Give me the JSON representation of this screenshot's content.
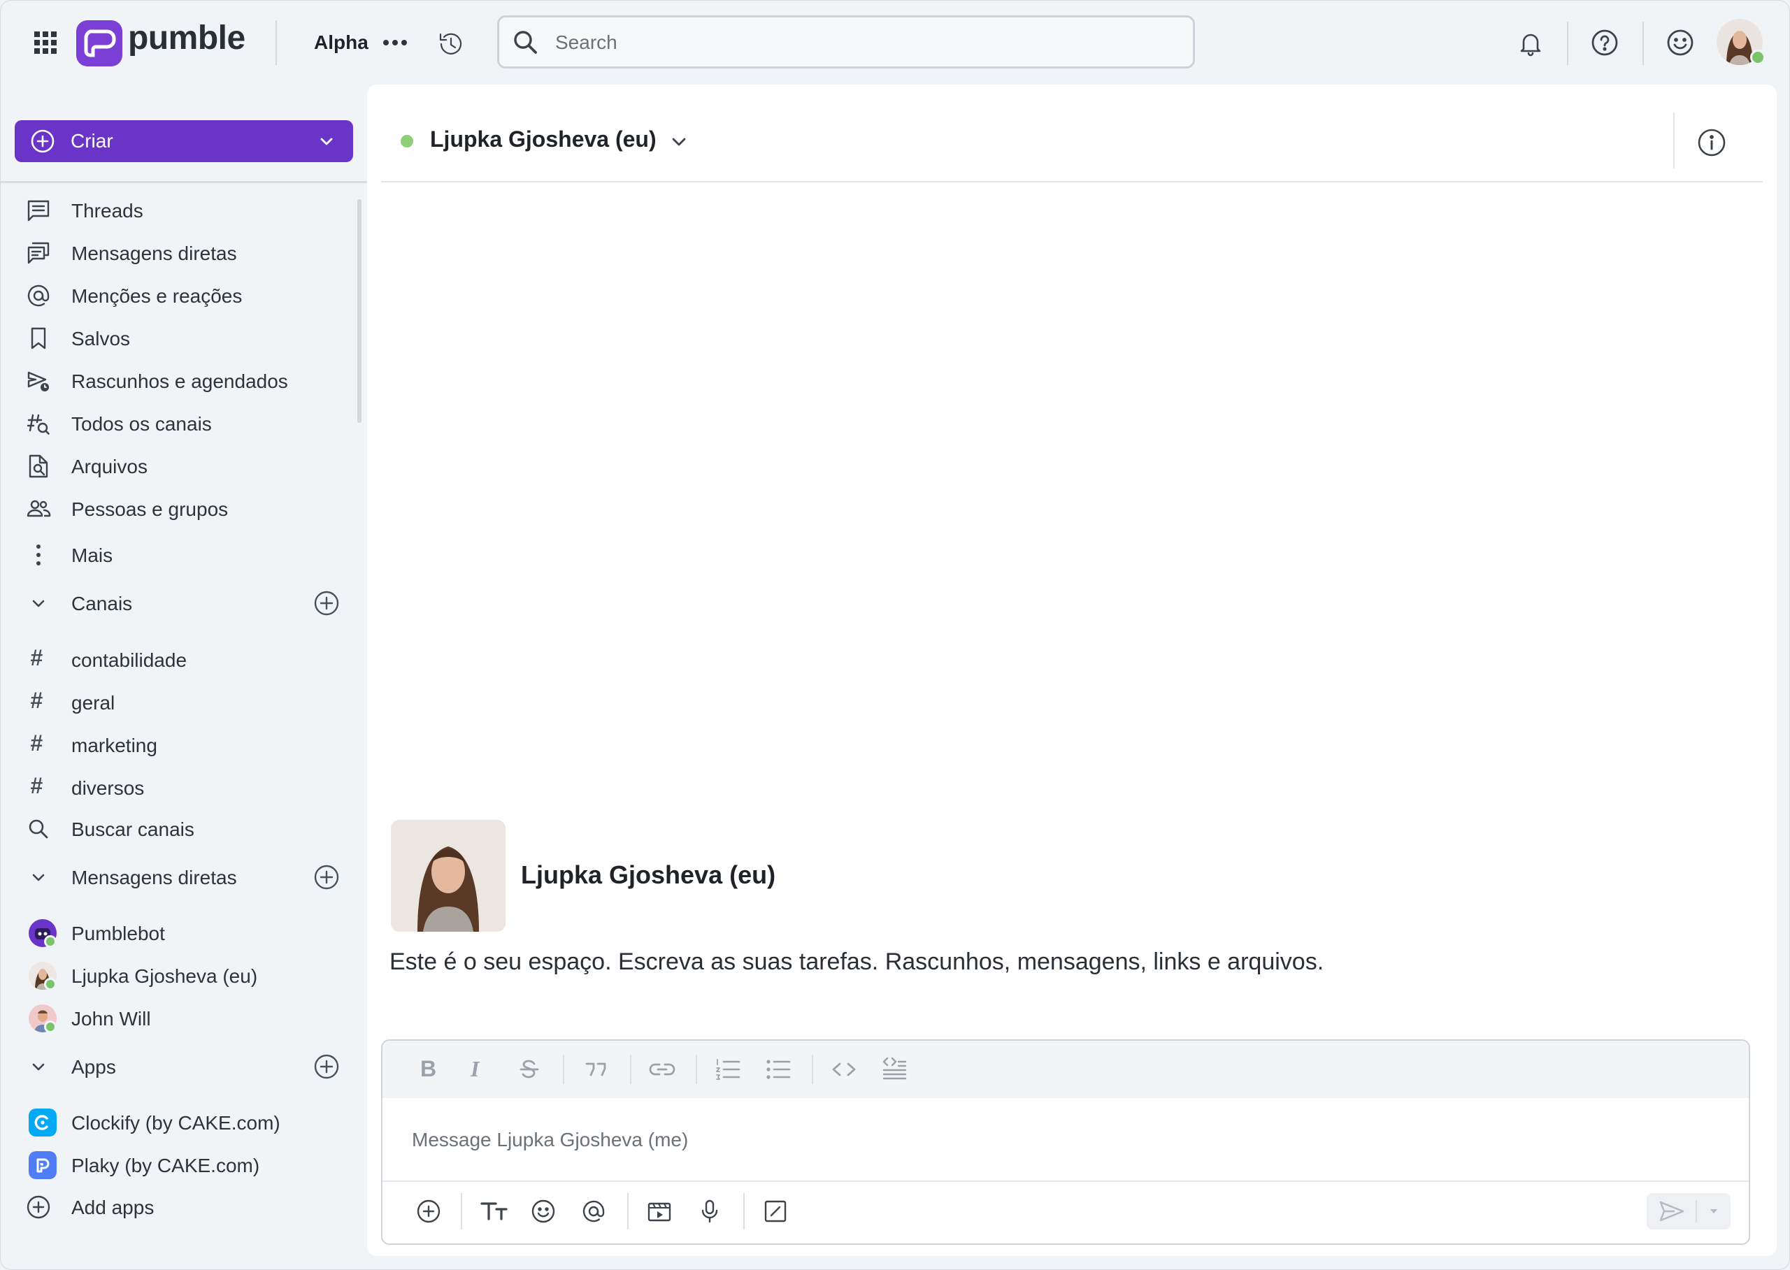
{
  "app": {
    "name": "pumble",
    "workspace": "Alpha"
  },
  "search": {
    "placeholder": "Search"
  },
  "sidebar": {
    "create_label": "Criar",
    "nav": [
      {
        "label": "Threads",
        "icon": "threads-icon"
      },
      {
        "label": "Mensagens diretas",
        "icon": "direct-messages-icon"
      },
      {
        "label": "Menções e reações",
        "icon": "at-sign-icon"
      },
      {
        "label": "Salvos",
        "icon": "bookmark-icon"
      },
      {
        "label": "Rascunhos e agendados",
        "icon": "drafts-scheduled-icon"
      },
      {
        "label": "Todos os canais",
        "icon": "channel-search-icon"
      },
      {
        "label": "Arquivos",
        "icon": "file-search-icon"
      },
      {
        "label": "Pessoas e grupos",
        "icon": "people-icon"
      }
    ],
    "more_label": "Mais",
    "channels_section": "Canais",
    "channels": [
      "contabilidade",
      "geral",
      "marketing",
      "diversos"
    ],
    "browse_channels": "Buscar canais",
    "dm_section": "Mensagens diretas",
    "dms": [
      "Pumblebot",
      "Ljupka Gjosheva (eu)",
      "John Will"
    ],
    "apps_section": "Apps",
    "apps": [
      "Clockify (by CAKE.com)",
      "Plaky (by CAKE.com)"
    ],
    "add_apps": "Add apps"
  },
  "main": {
    "title": "Ljupka Gjosheva (eu)",
    "intro_name": "Ljupka Gjosheva (eu)",
    "intro_text": "Este é o seu espaço. Escreva as suas tarefas. Rascunhos, mensagens, links e arquivos.",
    "composer_placeholder": "Message Ljupka Gjosheva (me)"
  },
  "colors": {
    "brand": "#6b34c8",
    "presence": "#7ac36a"
  }
}
